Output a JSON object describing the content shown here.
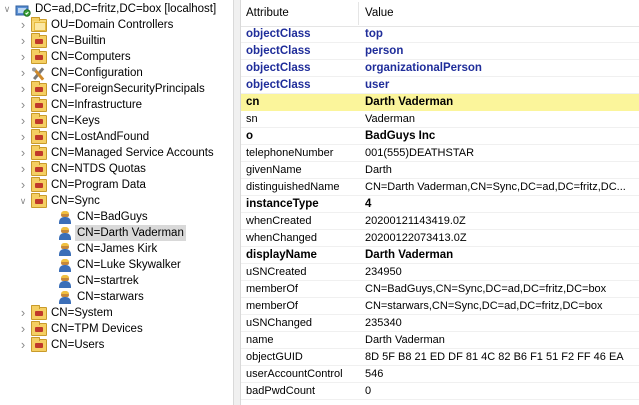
{
  "tree": {
    "root": {
      "label": "DC=ad,DC=fritz,DC=box [localhost]",
      "icon": "directory-root-icon"
    },
    "children": [
      {
        "label": "OU=Domain Controllers",
        "icon": "ou-folder-icon"
      },
      {
        "label": "CN=Builtin",
        "icon": "container-folder-icon"
      },
      {
        "label": "CN=Computers",
        "icon": "container-folder-icon"
      },
      {
        "label": "CN=Configuration",
        "icon": "configuration-tool-icon"
      },
      {
        "label": "CN=ForeignSecurityPrincipals",
        "icon": "container-folder-icon"
      },
      {
        "label": "CN=Infrastructure",
        "icon": "container-folder-icon"
      },
      {
        "label": "CN=Keys",
        "icon": "container-folder-icon"
      },
      {
        "label": "CN=LostAndFound",
        "icon": "container-folder-icon"
      },
      {
        "label": "CN=Managed Service Accounts",
        "icon": "container-folder-icon"
      },
      {
        "label": "CN=NTDS Quotas",
        "icon": "container-folder-icon"
      },
      {
        "label": "CN=Program Data",
        "icon": "container-folder-icon"
      },
      {
        "label": "CN=Sync",
        "icon": "container-folder-icon",
        "expanded": true,
        "children": [
          {
            "label": "CN=BadGuys",
            "icon": "user-icon"
          },
          {
            "label": "CN=Darth Vaderman",
            "icon": "user-icon",
            "selected": true
          },
          {
            "label": "CN=James Kirk",
            "icon": "user-icon"
          },
          {
            "label": "CN=Luke Skywalker",
            "icon": "user-icon"
          },
          {
            "label": "CN=startrek",
            "icon": "user-icon"
          },
          {
            "label": "CN=starwars",
            "icon": "user-icon"
          }
        ]
      },
      {
        "label": "CN=System",
        "icon": "container-folder-icon"
      },
      {
        "label": "CN=TPM Devices",
        "icon": "container-folder-icon"
      },
      {
        "label": "CN=Users",
        "icon": "container-folder-icon"
      }
    ]
  },
  "attributes": {
    "columns": {
      "name": "Attribute",
      "value": "Value"
    },
    "rows": [
      {
        "name": "objectClass",
        "value": "top",
        "style": "blue"
      },
      {
        "name": "objectClass",
        "value": "person",
        "style": "blue"
      },
      {
        "name": "objectClass",
        "value": "organizationalPerson",
        "style": "blue"
      },
      {
        "name": "objectClass",
        "value": "user",
        "style": "blue"
      },
      {
        "name": "cn",
        "value": "Darth Vaderman",
        "style": "highlight"
      },
      {
        "name": "sn",
        "value": "Vaderman",
        "style": "plain"
      },
      {
        "name": "o",
        "value": "BadGuys Inc",
        "style": "bold"
      },
      {
        "name": "telephoneNumber",
        "value": "001(555)DEATHSTAR",
        "style": "plain"
      },
      {
        "name": "givenName",
        "value": "Darth",
        "style": "plain"
      },
      {
        "name": "distinguishedName",
        "value": "CN=Darth Vaderman,CN=Sync,DC=ad,DC=fritz,DC...",
        "style": "plain"
      },
      {
        "name": "instanceType",
        "value": "4",
        "style": "bold"
      },
      {
        "name": "whenCreated",
        "value": "20200121143419.0Z",
        "style": "plain"
      },
      {
        "name": "whenChanged",
        "value": "20200122073413.0Z",
        "style": "plain"
      },
      {
        "name": "displayName",
        "value": "Darth Vaderman",
        "style": "bold"
      },
      {
        "name": "uSNCreated",
        "value": "234950",
        "style": "plain"
      },
      {
        "name": "memberOf",
        "value": "CN=BadGuys,CN=Sync,DC=ad,DC=fritz,DC=box",
        "style": "plain"
      },
      {
        "name": "memberOf",
        "value": "CN=starwars,CN=Sync,DC=ad,DC=fritz,DC=box",
        "style": "plain"
      },
      {
        "name": "uSNChanged",
        "value": "235340",
        "style": "plain"
      },
      {
        "name": "name",
        "value": "Darth Vaderman",
        "style": "plain"
      },
      {
        "name": "objectGUID",
        "value": "8D 5F B8 21 ED DF 81 4C 82 B6 F1 51 F2 FF 46 EA",
        "style": "plain"
      },
      {
        "name": "userAccountControl",
        "value": "546",
        "style": "plain"
      },
      {
        "name": "badPwdCount",
        "value": "0",
        "style": "plain"
      }
    ]
  },
  "colors": {
    "highlight": "#fbf59b",
    "blue_text": "#1f2d9a",
    "selection": "#d9d9d9"
  }
}
